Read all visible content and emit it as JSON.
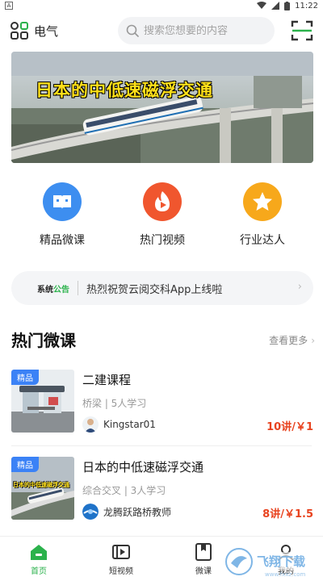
{
  "status_bar": {
    "time": "11:22",
    "left_icon": "A"
  },
  "header": {
    "category_label": "电气",
    "search_placeholder": "搜索您想要的内容",
    "icons": [
      "category-grid-icon",
      "search-icon",
      "scan-icon"
    ]
  },
  "banner": {
    "caption": "日本的中低速磁浮交通"
  },
  "quick_entries": [
    {
      "label": "精品微课",
      "icon": "book-icon",
      "color": "#3d8ef0"
    },
    {
      "label": "热门视频",
      "icon": "fire-play-icon",
      "color": "#f0562e"
    },
    {
      "label": "行业达人",
      "icon": "star-icon",
      "color": "#f7a81b"
    }
  ],
  "notice": {
    "tag_black": "系统",
    "tag_green": "公告",
    "text": "热烈祝贺云阅交科App上线啦"
  },
  "section": {
    "title": "热门微课",
    "more_label": "查看更多"
  },
  "courses": [
    {
      "badge": "精品",
      "title": "二建课程",
      "meta": "桥梁 | 5人学习",
      "author": "Kingstar01",
      "price": "10讲/￥1"
    },
    {
      "badge": "精品",
      "title": "日本的中低速磁浮交通",
      "meta": "综合交叉 | 3人学习",
      "author": "龙腾跃路桥教师",
      "price": "8讲/￥1.5",
      "thumb_caption": "日本的中低速磁浮交通"
    }
  ],
  "bottom_nav": [
    {
      "label": "首页",
      "icon": "home-icon",
      "active": true
    },
    {
      "label": "短视频",
      "icon": "video-icon",
      "active": false
    },
    {
      "label": "微课",
      "icon": "bookmark-icon",
      "active": false
    },
    {
      "label": "我的",
      "icon": "profile-icon",
      "active": false
    }
  ],
  "watermark": {
    "text": "飞翔下载",
    "site": "www.fxxz.com"
  },
  "colors": {
    "accent": "#2bb24c",
    "price": "#e8431f",
    "badge": "#3b82f6"
  }
}
